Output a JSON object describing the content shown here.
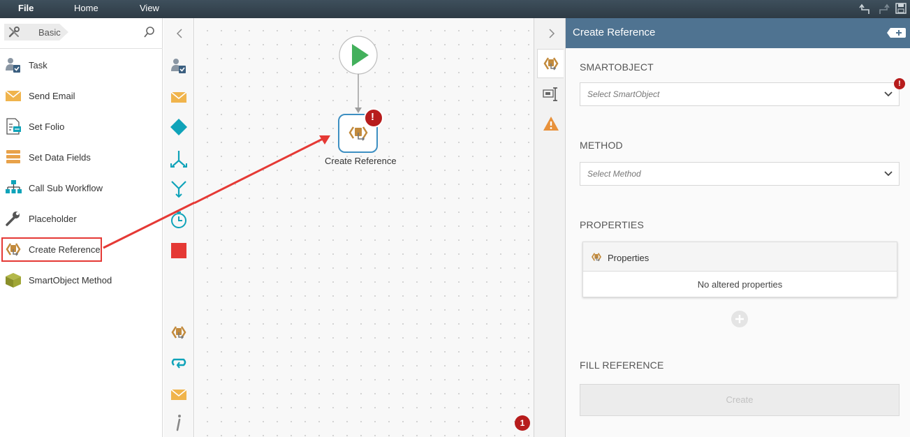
{
  "menu": {
    "file": "File",
    "home": "Home",
    "view": "View"
  },
  "toolbox": {
    "category": "Basic",
    "items": [
      {
        "label": "Task",
        "icon": "task-user-icon"
      },
      {
        "label": "Send Email",
        "icon": "envelope-icon"
      },
      {
        "label": "Set Folio",
        "icon": "folio-icon"
      },
      {
        "label": "Set Data Fields",
        "icon": "data-fields-icon"
      },
      {
        "label": "Call Sub Workflow",
        "icon": "sub-workflow-icon"
      },
      {
        "label": "Placeholder",
        "icon": "wrench-icon"
      },
      {
        "label": "Create Reference",
        "icon": "create-reference-icon"
      },
      {
        "label": "SmartObject Method",
        "icon": "smartobject-cube-icon"
      }
    ]
  },
  "canvas": {
    "node_label": "Create Reference",
    "error_count": "1",
    "node_error": "!"
  },
  "panel": {
    "title": "Create Reference",
    "smartobject_label": "SMARTOBJECT",
    "smartobject_placeholder": "Select SmartObject",
    "smartobject_error": "!",
    "method_label": "METHOD",
    "method_placeholder": "Select Method",
    "properties_label": "PROPERTIES",
    "properties_card_title": "Properties",
    "properties_empty": "No altered properties",
    "fill_reference_label": "FILL REFERENCE",
    "create_button": "Create"
  },
  "colors": {
    "topbar": "#2e3b45",
    "panel_header": "#4f7391",
    "highlight": "#e53935",
    "error": "#b71c1c",
    "start_green": "#43b05c",
    "teal": "#0fa3b9",
    "node_border": "#3d8fc2"
  }
}
